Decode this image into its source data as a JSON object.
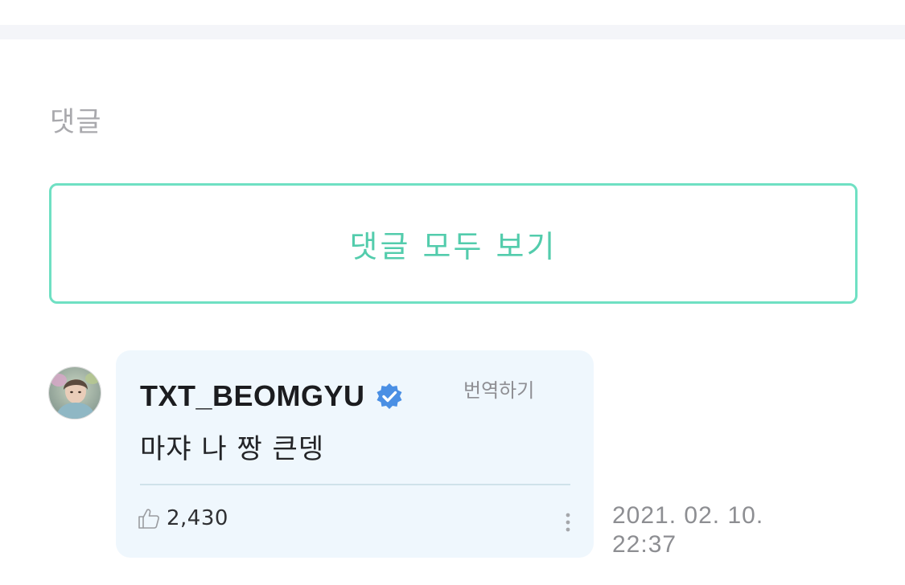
{
  "comments_section": {
    "title": "댓글",
    "view_all_label": "댓글 모두 보기",
    "accent_color": "#6fe0c3"
  },
  "comment": {
    "author": "TXT_BEOMGYU",
    "verified_icon": "verified-badge-icon",
    "translate_label": "번역하기",
    "text": "마쟈 나 짱 큰뎅",
    "likes": "2,430",
    "like_icon": "thumbs-up-icon",
    "more_icon": "more-vertical-icon",
    "timestamp_date": "2021. 02. 10.",
    "timestamp_time": "22:37",
    "bubble_color": "#eff7fd"
  }
}
